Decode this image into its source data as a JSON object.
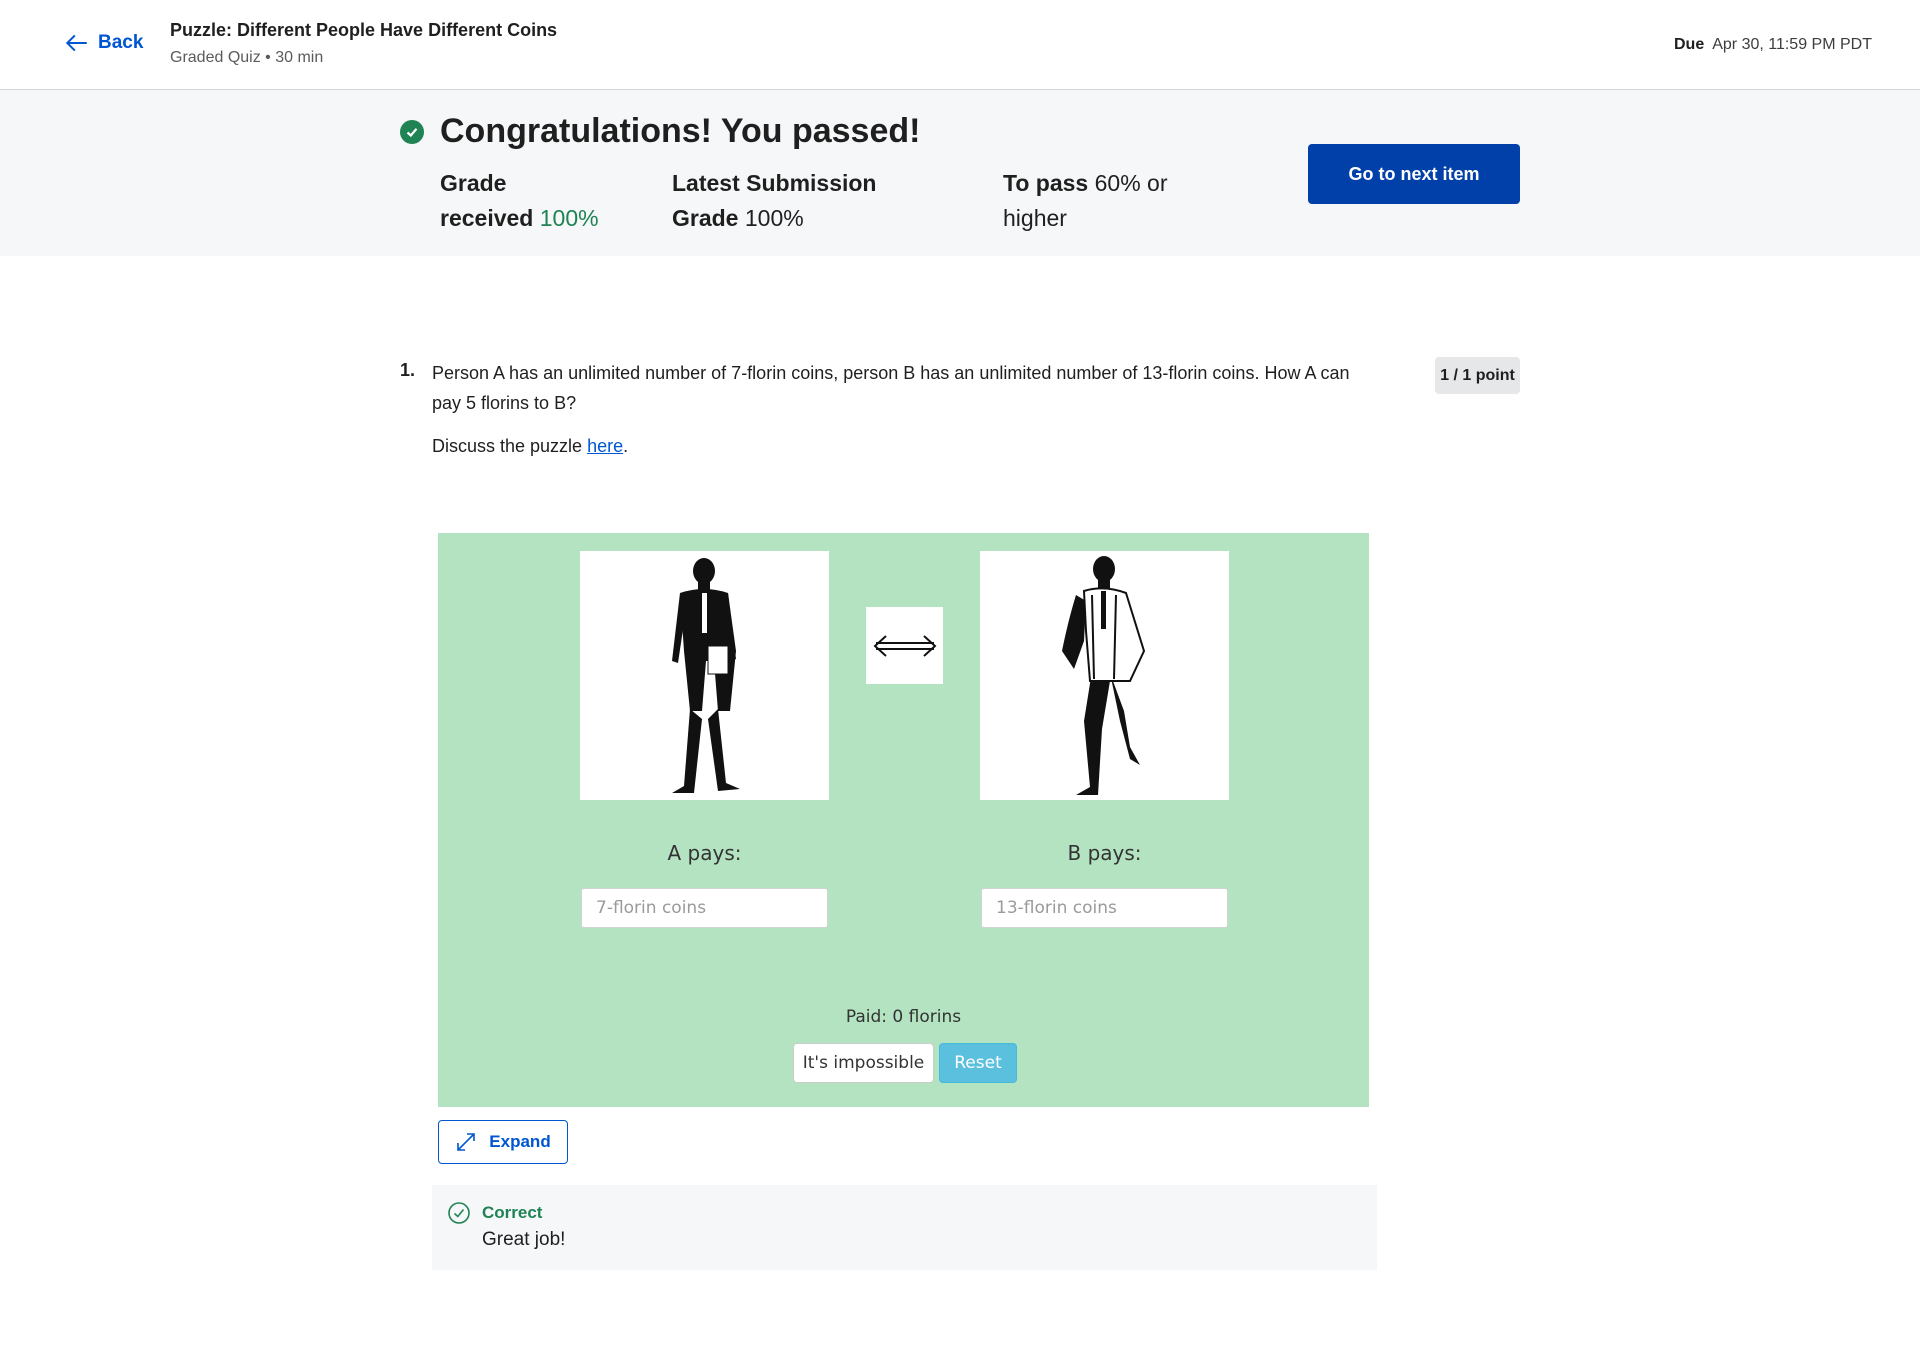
{
  "header": {
    "back_label": "Back",
    "title": "Puzzle: Different People Have Different Coins",
    "subtitle": "Graded Quiz • 30 min",
    "due_label": "Due",
    "due_value": "Apr 30, 11:59 PM PDT"
  },
  "banner": {
    "message": "Congratulations! You passed!",
    "grade_received_label_line1": "Grade",
    "grade_received_label_line2": "received",
    "grade_received_value": "100%",
    "latest_label_line1": "Latest Submission",
    "latest_label_line2": "Grade",
    "latest_value": "100%",
    "to_pass_label": "To pass",
    "to_pass_value_line1": "60% or",
    "to_pass_value_line2": "higher",
    "next_button": "Go to next item"
  },
  "question": {
    "number": "1.",
    "text": "Person A has an unlimited number of 7-florin coins, person B has an unlimited number of 13-florin coins. How A can pay 5 florins to B?",
    "discuss_prefix": "Discuss the puzzle ",
    "discuss_link": "here",
    "discuss_suffix": ".",
    "points": "1 / 1 point"
  },
  "widget": {
    "a_pays": "A pays:",
    "b_pays": "B pays:",
    "a_placeholder": "7-florin coins",
    "b_placeholder": "13-florin coins",
    "paid_text": "Paid: 0 florins",
    "impossible_button": "It's impossible",
    "reset_button": "Reset",
    "background_color": "#b3e3c0"
  },
  "expand_button": "Expand",
  "feedback": {
    "title": "Correct",
    "text": "Great job!",
    "color": "#1f8354"
  }
}
